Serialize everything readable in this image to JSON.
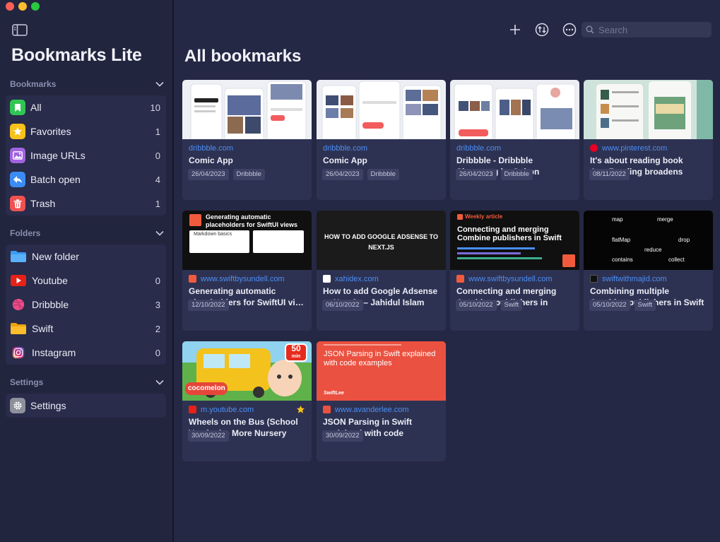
{
  "app": {
    "title": "Bookmarks Lite"
  },
  "colors": {
    "accent": "#4a8ef5",
    "background": "#252844",
    "sidebar": "#22253e",
    "card": "#2e3252"
  },
  "sidebar": {
    "bookmarks_section": "Bookmarks",
    "bookmarks": [
      {
        "label": "All",
        "count": "10",
        "icon": "bookmark-icon",
        "color": "#2fc654"
      },
      {
        "label": "Favorites",
        "count": "1",
        "icon": "star-icon",
        "color": "#f7c21c"
      },
      {
        "label": "Image URLs",
        "count": "0",
        "icon": "photo-icon",
        "color": "#a064e0"
      },
      {
        "label": "Batch open",
        "count": "4",
        "icon": "batch-open-icon",
        "color": "#3b8cf5"
      },
      {
        "label": "Trash",
        "count": "1",
        "icon": "trash-icon",
        "color": "#f05151"
      }
    ],
    "folders_section": "Folders",
    "folders": [
      {
        "label": "New folder",
        "count": "",
        "icon": "folder-icon"
      },
      {
        "label": "Youtube",
        "count": "0",
        "icon": "youtube-icon"
      },
      {
        "label": "Dribbble",
        "count": "3",
        "icon": "dribbble-icon"
      },
      {
        "label": "Swift",
        "count": "2",
        "icon": "folder-icon"
      },
      {
        "label": "Instagram",
        "count": "0",
        "icon": "instagram-icon"
      }
    ],
    "settings_section": "Settings",
    "settings_item": "Settings"
  },
  "toolbar": {
    "search_placeholder": "Search"
  },
  "main": {
    "title": "All bookmarks"
  },
  "cards": [
    {
      "host": "dribbble.com",
      "title": "Comic App",
      "date": "26/04/2023",
      "tag": "Dribbble",
      "favorite": false
    },
    {
      "host": "dribbble.com",
      "title": "Comic App",
      "date": "26/04/2023",
      "tag": "Dribbble",
      "favorite": false
    },
    {
      "host": "dribbble.com",
      "title": "Dribbble - Dribbble Shoot.png by Sulton handaya",
      "date": "26/04/2023",
      "tag": "Dribbble",
      "favorite": false
    },
    {
      "host": "www.pinterest.com",
      "title": "It's about reading book App.Reading broadens one…",
      "date": "08/11/2022",
      "tag": "",
      "favorite": false
    },
    {
      "host": "www.swiftbysundell.com",
      "title": "Generating automatic placeholders for SwiftUI vi…",
      "date": "12/10/2022",
      "tag": "",
      "favorite": false,
      "thumb_title": "Generating automatic placeholders for SwiftUI views",
      "thumb_text": "Markdown basics"
    },
    {
      "host": "xahidex.com",
      "title": "How to add Google Adsense to NextJs – Jahidul Islam",
      "date": "06/10/2022",
      "tag": "",
      "favorite": false,
      "thumb_title": "HOW TO ADD GOOGLE ADSENSE TO NEXT.JS"
    },
    {
      "host": "www.swiftbysundell.com",
      "title": "Connecting and merging Combine publishers in Swift…",
      "date": "05/10/2022",
      "tag": "Swift",
      "favorite": false,
      "thumb_kicker": "Weekly article",
      "thumb_title": "Connecting and merging Combine publishers in Swift"
    },
    {
      "host": "swiftwithmajid.com",
      "title": "Combining multiple Combine publishers in Swift",
      "date": "05/10/2022",
      "tag": "Swift",
      "favorite": false,
      "thumb_words": [
        "map",
        "merge",
        "flatMap",
        "reduce",
        "drop",
        "contains",
        "collect"
      ]
    },
    {
      "host": "m.youtube.com",
      "title": "Wheels on the Bus (School Version) + More Nursery Rh…",
      "date": "30/09/2022",
      "tag": "",
      "favorite": true,
      "thumb_badge": "50",
      "thumb_badge_unit": "min",
      "thumb_logo": "cocomelon"
    },
    {
      "host": "www.avanderlee.com",
      "title": "JSON Parsing in Swift explained with code examples",
      "date": "30/09/2022",
      "tag": "",
      "favorite": false,
      "thumb_title": "JSON Parsing in Swift explained with code examples",
      "thumb_logo": "SwiftLee"
    }
  ]
}
